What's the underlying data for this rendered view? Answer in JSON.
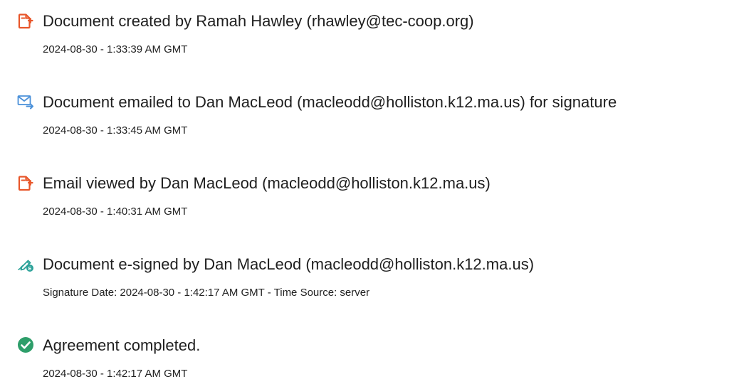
{
  "events": [
    {
      "icon": "document-created-icon",
      "title": "Document created by Ramah Hawley (rhawley@tec-coop.org)",
      "detail": "2024-08-30 - 1:33:39 AM GMT"
    },
    {
      "icon": "email-sent-icon",
      "title": "Document emailed to Dan MacLeod (macleodd@holliston.k12.ma.us) for signature",
      "detail": "2024-08-30 - 1:33:45 AM GMT"
    },
    {
      "icon": "email-viewed-icon",
      "title": "Email viewed by Dan MacLeod (macleodd@holliston.k12.ma.us)",
      "detail": "2024-08-30 - 1:40:31 AM GMT"
    },
    {
      "icon": "e-signature-icon",
      "title": "Document e-signed by Dan MacLeod (macleodd@holliston.k12.ma.us)",
      "detail": "Signature Date: 2024-08-30 - 1:42:17 AM GMT - Time Source: server"
    },
    {
      "icon": "completed-check-icon",
      "title": "Agreement completed.",
      "detail": "2024-08-30 - 1:42:17 AM GMT"
    }
  ],
  "colors": {
    "document_icon": "#e8562a",
    "email_icon": "#4a90d9",
    "sign_icon": "#2aa198",
    "check_icon": "#2e9e6a"
  }
}
